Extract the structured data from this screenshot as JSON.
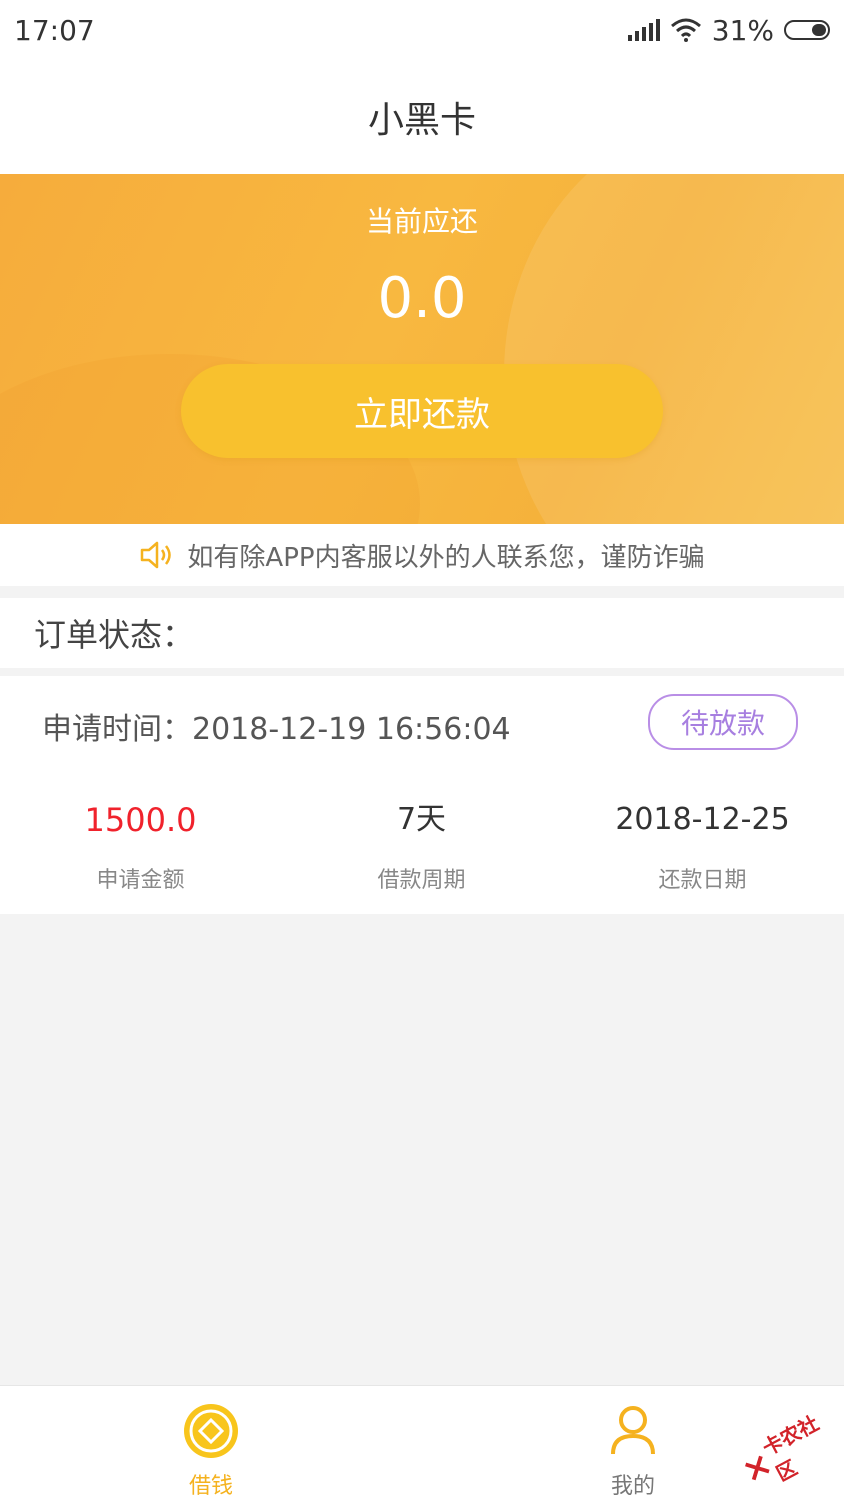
{
  "status_bar": {
    "time": "17:07",
    "battery_percent": "31%"
  },
  "header": {
    "title": "小黑卡"
  },
  "hero": {
    "label": "当前应还",
    "amount": "0.0",
    "button_label": "立即还款"
  },
  "notice": {
    "text": "如有除APP内客服以外的人联系您，谨防诈骗",
    "icon": "speaker-icon"
  },
  "order": {
    "section_title": "订单状态：",
    "apply_time": "申请时间：2018-12-19 16:56:04",
    "status": "待放款",
    "stats": [
      {
        "value": "1500.0",
        "label": "申请金额"
      },
      {
        "value": "7天",
        "label": "借款周期"
      },
      {
        "value": "2018-12-25",
        "label": "还款日期"
      }
    ]
  },
  "tabs": [
    {
      "label": "借钱",
      "icon": "coin-icon",
      "active": true
    },
    {
      "label": "我的",
      "icon": "user-icon",
      "active": false
    }
  ],
  "watermark": {
    "text": "卡农社区"
  },
  "colors": {
    "accent": "#f5b21f",
    "hero": "#f7b43f",
    "amount_red": "#f0222c",
    "status_purple": "#b98ee6"
  }
}
